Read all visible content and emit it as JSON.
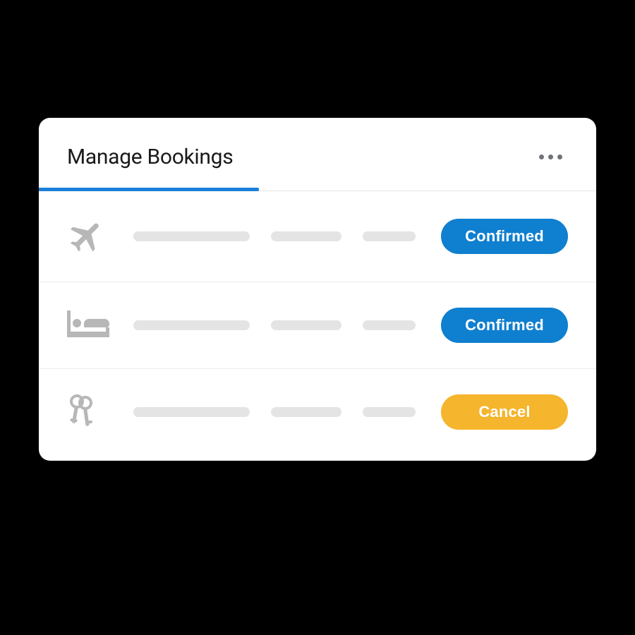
{
  "header": {
    "title": "Manage Bookings"
  },
  "colors": {
    "primary": "#0f7fd0",
    "warning": "#f5b52c",
    "tab_indicator": "#1a80d9",
    "icon": "#b7b7b7",
    "placeholder": "#e4e4e4"
  },
  "bookings": [
    {
      "icon": "airplane-icon",
      "status_label": "Confirmed",
      "status_variant": "primary"
    },
    {
      "icon": "bed-icon",
      "status_label": "Confirmed",
      "status_variant": "primary"
    },
    {
      "icon": "car-keys-icon",
      "status_label": "Cancel",
      "status_variant": "warning"
    }
  ]
}
